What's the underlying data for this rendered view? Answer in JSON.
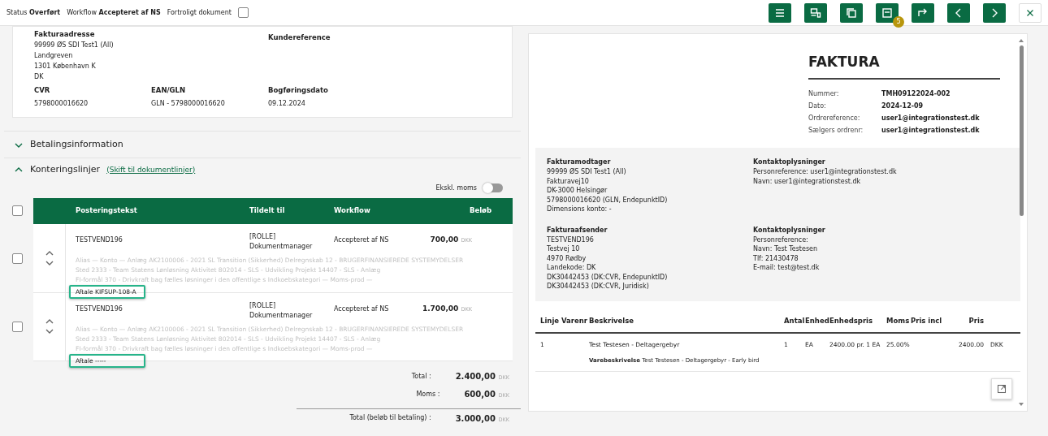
{
  "status_bar": {
    "status_label": "Status",
    "status_value": "Overført",
    "workflow_label": "Workflow",
    "workflow_value": "Accepteret af NS",
    "confidential_label": "Fortroligt dokument",
    "confidential_checked": false
  },
  "toolbar": [
    {
      "kind": "menu"
    },
    {
      "kind": "layout"
    },
    {
      "kind": "copy"
    },
    {
      "kind": "doc",
      "badge": "5"
    },
    {
      "kind": "forward"
    },
    {
      "kind": "prev"
    },
    {
      "kind": "next"
    },
    {
      "kind": "close"
    }
  ],
  "invoice_header": {
    "address_label": "Fakturaadresse",
    "address_lines": [
      "99999 ØS SDI Test1 (All)",
      "Landgreven",
      "1301 København K",
      "DK"
    ],
    "customer_ref_label": "Kundereference",
    "fields": [
      {
        "label": "CVR",
        "value": "5798000016620"
      },
      {
        "label": "EAN/GLN",
        "value": "GLN - 5798000016620"
      },
      {
        "label": "Bogføringsdato",
        "value": "09.12.2024"
      }
    ]
  },
  "sections": [
    {
      "title": "Betalingsinformation",
      "expanded": false
    },
    {
      "title": "Konteringslinjer",
      "expanded": true,
      "link": "(Skift til dokumentlinjer)"
    }
  ],
  "vat_toggle": {
    "label": "Ekskl. moms",
    "on": false
  },
  "table": {
    "select_all_checked": false,
    "columns": [
      "Posteringstekst",
      "Tildelt til",
      "Workflow",
      "Beløb"
    ],
    "rows": [
      {
        "checked": false,
        "text": "TESTVEND196",
        "assigned": [
          "[ROLLE]",
          "Dokumentmanager"
        ],
        "workflow": "Accepteret af NS",
        "amount": "700,00",
        "currency": "DKK",
        "details": [
          [
            {
              "label": "Alias",
              "value": "—"
            },
            {
              "label": "Konto",
              "value": "—"
            },
            {
              "label": "Anlæg",
              "value": "AK2100006 - 2021 SL Transition (Sikkerhed)"
            },
            {
              "label": "Delregnskab",
              "value": "12 - BRUGERFINANSIEREDE SYSTEMYDELSER"
            }
          ],
          [
            {
              "label": "Sted",
              "value": "2333 - Team Statens Lønløsning"
            },
            {
              "label": "Aktivitet",
              "value": "802014 - SLS - Udvikling"
            },
            {
              "label": "Projekt",
              "value": "14407 - SLS - Anlæg"
            }
          ],
          [
            {
              "label": "FI-formål",
              "value": "370 - Drivkraft bag fælles løsninger i den offentlige s"
            },
            {
              "label": "Indkoebskategori",
              "value": "—"
            },
            {
              "label": "Moms-prod",
              "value": "—"
            }
          ]
        ],
        "agreement": {
          "label": "Aftale",
          "value": "KIFSUP-108-A",
          "highlighted": true
        }
      },
      {
        "checked": false,
        "text": "TESTVEND196",
        "assigned": [
          "[ROLLE]",
          "Dokumentmanager"
        ],
        "workflow": "Accepteret af NS",
        "amount": "1.700,00",
        "currency": "DKK",
        "details": [
          [
            {
              "label": "Alias",
              "value": "—"
            },
            {
              "label": "Konto",
              "value": "—"
            },
            {
              "label": "Anlæg",
              "value": "AK2100006 - 2021 SL Transition (Sikkerhed)"
            },
            {
              "label": "Delregnskab",
              "value": "12 - BRUGERFINANSIEREDE SYSTEMYDELSER"
            }
          ],
          [
            {
              "label": "Sted",
              "value": "2333 - Team Statens Lønløsning"
            },
            {
              "label": "Aktivitet",
              "value": "802014 - SLS - Udvikling"
            },
            {
              "label": "Projekt",
              "value": "14407 - SLS - Anlæg"
            }
          ],
          [
            {
              "label": "FI-formål",
              "value": "370 - Drivkraft bag fælles løsninger i den offentlige s"
            },
            {
              "label": "Indkoebskategori",
              "value": "—"
            },
            {
              "label": "Moms-prod",
              "value": "—"
            }
          ]
        ],
        "agreement": {
          "label": "Aftale",
          "value": "-----",
          "highlighted": true
        }
      }
    ]
  },
  "totals": [
    {
      "label": "Total :",
      "value": "2.400,00",
      "currency": "DKK"
    },
    {
      "label": "Moms :",
      "value": "600,00",
      "currency": "DKK"
    },
    {
      "label": "Total (beløb til betaling) :",
      "value": "3.000,00",
      "currency": "DKK"
    }
  ],
  "document": {
    "title": "FAKTURA",
    "meta": [
      {
        "label": "Nummer:",
        "value": "TMH09122024-002"
      },
      {
        "label": "Dato:",
        "value": "2024-12-09"
      },
      {
        "label": "Ordrereference:",
        "value": "user1@integrationstest.dk"
      },
      {
        "label": "Sælgers ordrenr:",
        "value": "user1@integrationstest.dk"
      }
    ],
    "parties": [
      {
        "title": "Fakturamodtager",
        "lines": [
          "99999 ØS SDI Test1 (All)",
          "Fakturavej10",
          "DK-3000  Helsingør",
          "5798000016620 (GLN, EndepunktID)",
          "Dimensions konto: -"
        ]
      },
      {
        "title": "Kontaktoplysninger",
        "lines": [
          "Personreference: user1@integrationstest.dk",
          "Navn: user1@integrationstest.dk"
        ]
      },
      {
        "title": "Fakturaafsender",
        "lines": [
          "TESTVEND196",
          "Testvej 10",
          "4970  Rødby",
          "Landekode: DK",
          "DK30442453 (DK:CVR, EndepunktID)",
          "DK30442453 (DK:CVR, Juridisk)"
        ]
      },
      {
        "title": "Kontaktoplysninger",
        "lines": [
          "Personreference:",
          "Navn: Test Testesen",
          "Tlf: 21430478",
          "E-mail: test@test.dk"
        ]
      }
    ],
    "line_columns": [
      "Linje",
      "Varenr",
      "Beskrivelse",
      "Antal",
      "Enhed",
      "Enhedspris",
      "Moms",
      "Pris incl",
      "Pris",
      ""
    ],
    "lines": [
      {
        "cells": [
          "1",
          "",
          "Test Testesen - Deltagergebyr",
          "1",
          "EA",
          "2400.00 pr. 1 EA",
          "25.00%",
          "",
          "2400.00",
          "DKK"
        ],
        "desc_label": "Varebeskrivelse",
        "desc_value": "Test Testesen - Deltagergebyr - Early bird"
      }
    ]
  }
}
